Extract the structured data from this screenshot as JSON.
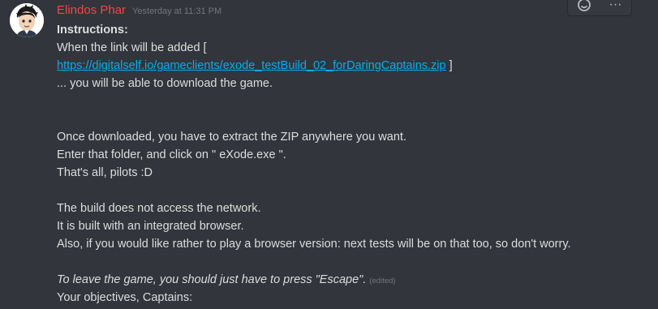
{
  "message": {
    "username": "Elindos Phar",
    "timestamp": "Yesterday at 11:31 PM",
    "lines": {
      "instructions": "Instructions:",
      "link_intro": "When the link will be added   [",
      "link_url": "https://digitalself.io/gameclients/exode_testBuild_02_forDaringCaptains.zip",
      "link_close": " ]",
      "download": "... you will be able to download the game.",
      "extract": "Once downloaded, you have to extract the ZIP anywhere you want.",
      "enter_folder": "Enter that folder, and click on \" eXode.exe \".",
      "thats_all": "That's all, pilots :D",
      "no_network": "The build does not access the network.",
      "browser": "It is built with an integrated browser.",
      "browser_version": "Also, if you would like rather to play a browser version: next tests will be on that too, so don't worry.",
      "escape": "To leave the game, you should just have to press \"Escape\".",
      "edited": "(edited)",
      "objectives": "Your objectives, Captains:"
    }
  },
  "toolbar": {
    "reaction_icon": "add-reaction-icon",
    "more_icon": "more-options-icon",
    "more_label": "···"
  },
  "colors": {
    "username": "#f04747",
    "link": "#00b0f4",
    "background": "#32353b"
  }
}
